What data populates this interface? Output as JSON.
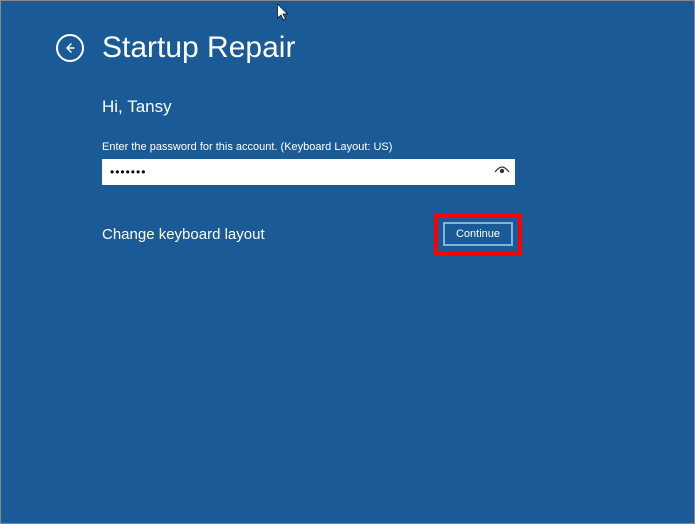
{
  "header": {
    "title": "Startup Repair"
  },
  "greeting": "Hi, Tansy",
  "instruction": "Enter the password for this account. (Keyboard Layout: US)",
  "password_value": "•••••••",
  "keyboard_link": "Change keyboard layout",
  "continue_label": "Continue"
}
